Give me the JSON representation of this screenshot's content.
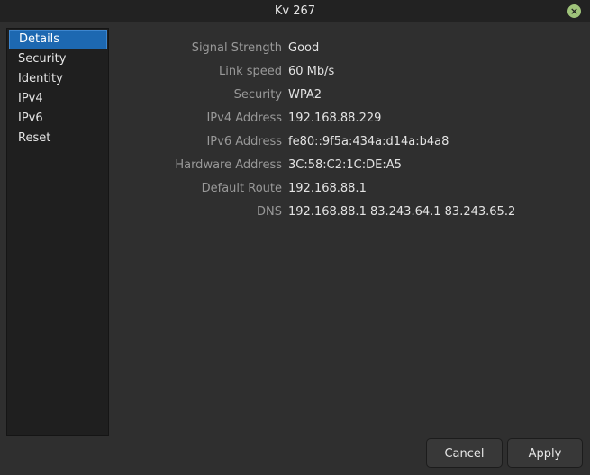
{
  "window": {
    "title": "Kv 267",
    "close_icon": "×"
  },
  "sidebar": {
    "items": [
      {
        "label": "Details",
        "active": true
      },
      {
        "label": "Security"
      },
      {
        "label": "Identity"
      },
      {
        "label": "IPv4"
      },
      {
        "label": "IPv6"
      },
      {
        "label": "Reset"
      }
    ]
  },
  "details": {
    "rows": [
      {
        "label": "Signal Strength",
        "value": "Good"
      },
      {
        "label": "Link speed",
        "value": "60 Mb/s"
      },
      {
        "label": "Security",
        "value": "WPA2"
      },
      {
        "label": "IPv4 Address",
        "value": "192.168.88.229"
      },
      {
        "label": "IPv6 Address",
        "value": "fe80::9f5a:434a:d14a:b4a8"
      },
      {
        "label": "Hardware Address",
        "value": "3C:58:C2:1C:DE:A5"
      },
      {
        "label": "Default Route",
        "value": "192.168.88.1"
      },
      {
        "label": "DNS",
        "value": "192.168.88.1 83.243.64.1 83.243.65.2"
      }
    ]
  },
  "buttons": {
    "cancel": "Cancel",
    "apply": "Apply"
  },
  "colors": {
    "accent": "#1d68b1",
    "close_button": "#9fc37a",
    "background": "#2f2f2f",
    "sidebar": "#1f1f1f"
  }
}
